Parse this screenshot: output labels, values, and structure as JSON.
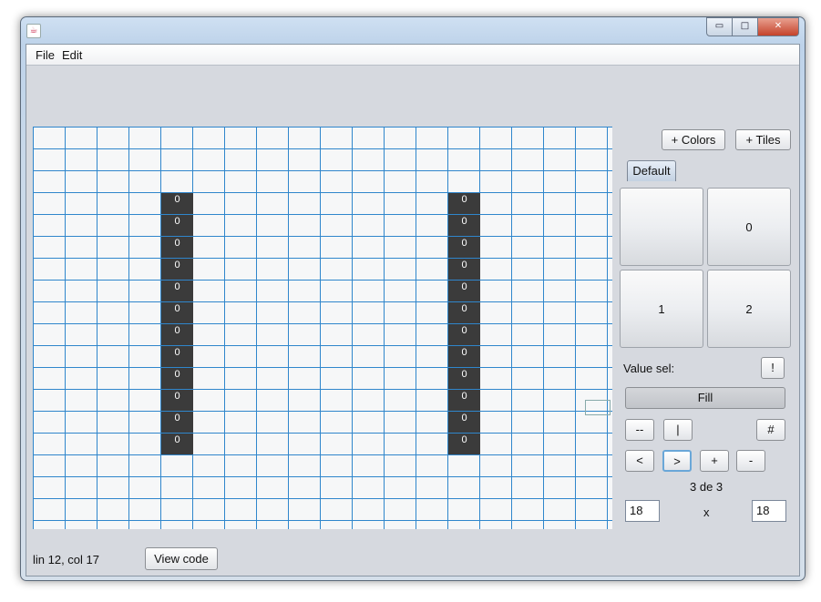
{
  "menu": [
    "File",
    "Edit"
  ],
  "window_controls": {
    "minimize": "▭",
    "maximize": "□",
    "close": "✕"
  },
  "grid": {
    "cell_value": "0"
  },
  "palette": {
    "add_colors": "+ Colors",
    "add_tiles": "+ Tiles",
    "tab": "Default",
    "tiles": [
      "",
      "0",
      "1",
      "2"
    ],
    "value_sel_label": "Value sel:",
    "value_sel_button": "!",
    "fill": "Fill",
    "tools": [
      "--",
      "|",
      "#"
    ],
    "nav": [
      "<",
      ">",
      "+",
      "-"
    ],
    "page": "3 de 3",
    "width": "18",
    "times": "x",
    "height": "18"
  },
  "status": {
    "position": "lin 12, col 17",
    "view_code": "View code"
  }
}
